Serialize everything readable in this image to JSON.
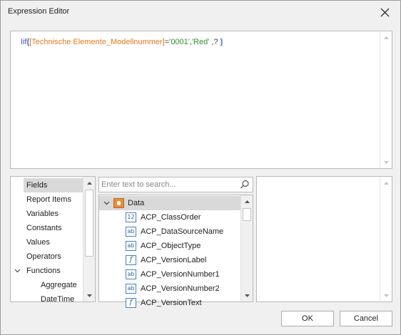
{
  "window": {
    "title": "Expression Editor",
    "close_icon": "close-icon"
  },
  "editor": {
    "tokens": [
      {
        "text": "Iif",
        "kind": "func"
      },
      {
        "text": "(",
        "kind": "bracket"
      },
      {
        "text": "[Technische Elemente_Modellnummer]",
        "kind": "field"
      },
      {
        "text": "=",
        "kind": "op"
      },
      {
        "text": "'0001'",
        "kind": "str"
      },
      {
        "text": ",",
        "kind": "op"
      },
      {
        "text": "'Red'",
        "kind": "str"
      },
      {
        "text": " ,? ",
        "kind": "op"
      },
      {
        "text": ")",
        "kind": "bracket"
      }
    ]
  },
  "categories": {
    "items": [
      {
        "label": "Fields",
        "selected": true
      },
      {
        "label": "Report Items"
      },
      {
        "label": "Variables"
      },
      {
        "label": "Constants"
      },
      {
        "label": "Values"
      },
      {
        "label": "Operators"
      },
      {
        "label": "Functions",
        "expanded": true
      },
      {
        "label": "Aggregate",
        "sub": true
      },
      {
        "label": "DateTime",
        "sub": true
      }
    ]
  },
  "search": {
    "placeholder": "Enter text to search...",
    "value": ""
  },
  "fields": {
    "root_label": "Data",
    "items": [
      {
        "label": "ACP_ClassOrder",
        "icon": "12"
      },
      {
        "label": "ACP_DataSourceName",
        "icon": "ab"
      },
      {
        "label": "ACP_ObjectType",
        "icon": "ab"
      },
      {
        "label": "ACP_VersionLabel",
        "icon": "f"
      },
      {
        "label": "ACP_VersionNumber1",
        "icon": "ab"
      },
      {
        "label": "ACP_VersionNumber2",
        "icon": "ab"
      },
      {
        "label": "ACP_VersionText",
        "icon": "f"
      }
    ]
  },
  "buttons": {
    "ok_label": "OK",
    "cancel_label": "Cancel"
  }
}
